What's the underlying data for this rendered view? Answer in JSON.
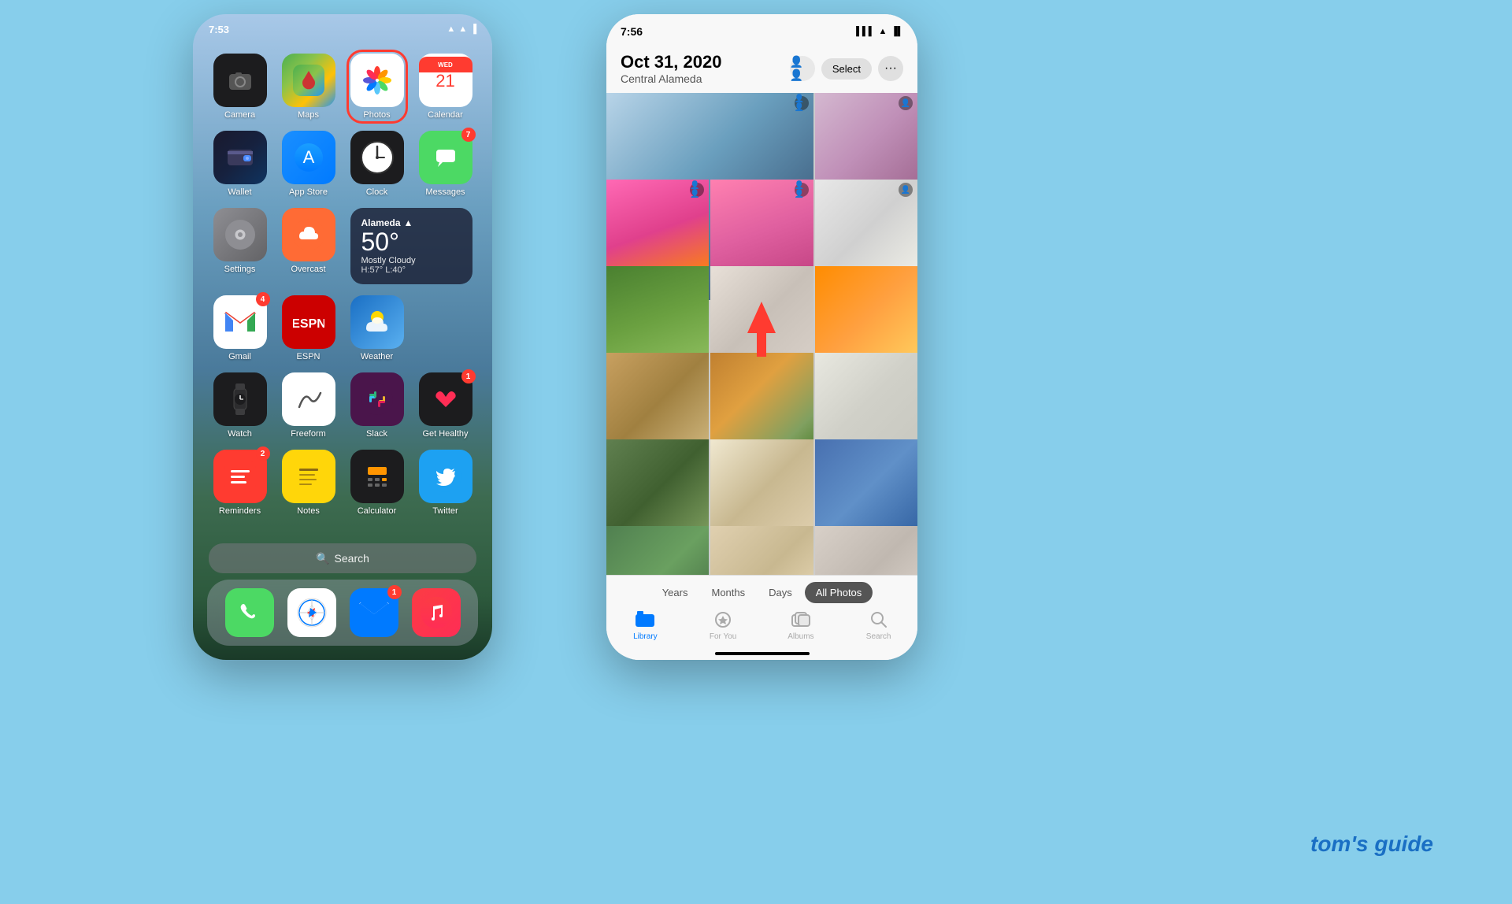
{
  "left_phone": {
    "status_bar": {
      "time": "7:53",
      "signal": "▌▌▌",
      "wifi": "WiFi",
      "battery": "🔋"
    },
    "apps": [
      {
        "id": "camera",
        "label": "Camera",
        "icon_type": "camera",
        "badge": null
      },
      {
        "id": "maps",
        "label": "Maps",
        "icon_type": "maps",
        "badge": null
      },
      {
        "id": "photos",
        "label": "Photos",
        "icon_type": "photos",
        "badge": null,
        "highlighted": true
      },
      {
        "id": "calendar",
        "label": "Calendar",
        "icon_type": "calendar",
        "badge": null
      },
      {
        "id": "wallet",
        "label": "Wallet",
        "icon_type": "wallet",
        "badge": null
      },
      {
        "id": "appstore",
        "label": "App Store",
        "icon_type": "appstore",
        "badge": null
      },
      {
        "id": "clock",
        "label": "Clock",
        "icon_type": "clock",
        "badge": null
      },
      {
        "id": "messages",
        "label": "Messages",
        "icon_type": "messages",
        "badge": "7"
      },
      {
        "id": "settings",
        "label": "Settings",
        "icon_type": "settings",
        "badge": null
      },
      {
        "id": "overcast",
        "label": "Overcast",
        "icon_type": "overcast",
        "badge": null
      },
      {
        "id": "weather_widget",
        "label": "",
        "icon_type": "weather",
        "badge": null
      },
      {
        "id": "gmail",
        "label": "Gmail",
        "icon_type": "gmail",
        "badge": "4"
      },
      {
        "id": "espn",
        "label": "ESPN",
        "icon_type": "espn",
        "badge": null
      },
      {
        "id": "weather_app",
        "label": "Weather",
        "icon_type": "weather_app",
        "badge": null
      },
      {
        "id": "watch",
        "label": "Watch",
        "icon_type": "watch",
        "badge": null
      },
      {
        "id": "freeform",
        "label": "Freeform",
        "icon_type": "freeform",
        "badge": null
      },
      {
        "id": "slack",
        "label": "Slack",
        "icon_type": "slack",
        "badge": null
      },
      {
        "id": "gethealthy",
        "label": "Get Healthy",
        "icon_type": "gethealthy",
        "badge": "1"
      },
      {
        "id": "reminders",
        "label": "Reminders",
        "icon_type": "reminders",
        "badge": "2"
      },
      {
        "id": "notes",
        "label": "Notes",
        "icon_type": "notes",
        "badge": null
      },
      {
        "id": "calculator",
        "label": "Calculator",
        "icon_type": "calculator",
        "badge": null
      },
      {
        "id": "twitter",
        "label": "Twitter",
        "icon_type": "twitter",
        "badge": null
      }
    ],
    "weather": {
      "city": "Alameda",
      "temp": "50°",
      "desc": "Mostly Cloudy",
      "high": "H:57°",
      "low": "L:40°"
    },
    "search_placeholder": "Search",
    "dock": [
      "Phone",
      "Safari",
      "Mail",
      "Music"
    ]
  },
  "right_phone": {
    "status_bar": {
      "time": "7:56"
    },
    "header": {
      "date": "Oct 31, 2020",
      "location": "Central Alameda",
      "select_label": "Select",
      "more_label": "···"
    },
    "segments": [
      "Years",
      "Months",
      "Days",
      "All Photos"
    ],
    "active_segment": "All Photos",
    "tabs": [
      {
        "id": "library",
        "label": "Library",
        "active": true
      },
      {
        "id": "foryou",
        "label": "For You",
        "active": false
      },
      {
        "id": "albums",
        "label": "Albums",
        "active": false
      },
      {
        "id": "search",
        "label": "Search",
        "active": false
      }
    ]
  },
  "branding": {
    "logo": "tom's guide"
  }
}
